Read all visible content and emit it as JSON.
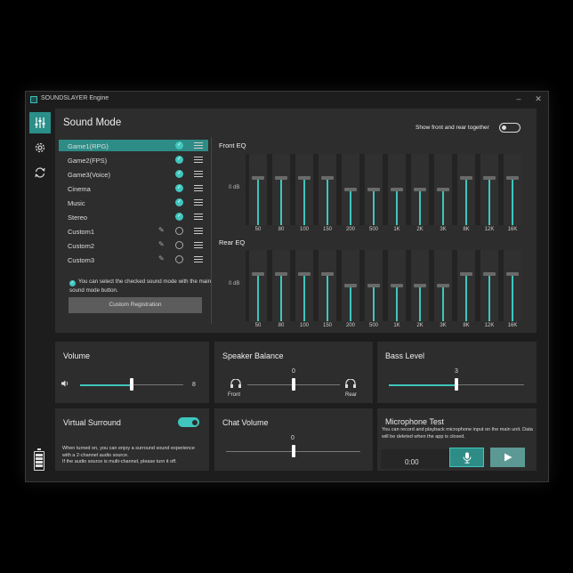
{
  "app": {
    "title": "SOUNDSLAYER Engine"
  },
  "window_controls": {
    "minimize": "–",
    "maximize": "□",
    "close": "✕"
  },
  "sidebar": {
    "items": [
      {
        "icon": "equalizer-icon",
        "active": true
      },
      {
        "icon": "gear-icon",
        "active": false
      },
      {
        "icon": "sync-icon",
        "active": false
      }
    ],
    "battery_icon": "battery-icon"
  },
  "sound_mode": {
    "title": "Sound Mode",
    "show_front_rear_label": "Show front and rear together",
    "show_front_rear_on": false,
    "modes": [
      {
        "label": "Game1(RPG)",
        "checked": true,
        "editable": false,
        "selected": true
      },
      {
        "label": "Game2(FPS)",
        "checked": true,
        "editable": false,
        "selected": false
      },
      {
        "label": "Game3(Voice)",
        "checked": true,
        "editable": false,
        "selected": false
      },
      {
        "label": "Cinema",
        "checked": true,
        "editable": false,
        "selected": false
      },
      {
        "label": "Music",
        "checked": true,
        "editable": false,
        "selected": false
      },
      {
        "label": "Stereo",
        "checked": true,
        "editable": false,
        "selected": false
      },
      {
        "label": "Custom1",
        "checked": false,
        "editable": true,
        "selected": false
      },
      {
        "label": "Custom2",
        "checked": false,
        "editable": true,
        "selected": false
      },
      {
        "label": "Custom3",
        "checked": false,
        "editable": true,
        "selected": false
      }
    ],
    "hint": "You can select the checked sound mode with the main sound mode button.",
    "custom_registration": "Custom Registration"
  },
  "eq": {
    "front_title": "Front EQ",
    "rear_title": "Rear EQ",
    "zero_label": "0 dB",
    "bands": [
      "50",
      "80",
      "100",
      "150",
      "200",
      "500",
      "1K",
      "2K",
      "3K",
      "8K",
      "12K",
      "16K"
    ],
    "front_levels": [
      0.66,
      0.66,
      0.66,
      0.66,
      0.5,
      0.5,
      0.5,
      0.5,
      0.5,
      0.66,
      0.66,
      0.66
    ],
    "rear_levels": [
      0.66,
      0.66,
      0.66,
      0.66,
      0.5,
      0.5,
      0.5,
      0.5,
      0.5,
      0.66,
      0.66,
      0.66
    ]
  },
  "volume": {
    "title": "Volume",
    "value": "8",
    "level": 0.5,
    "icon": "speaker-icon"
  },
  "speaker_balance": {
    "title": "Speaker Balance",
    "value": "0",
    "front_label": "Front",
    "rear_label": "Rear",
    "level": 0.5
  },
  "bass_level": {
    "title": "Bass Level",
    "value": "3",
    "level": 0.5
  },
  "virtual_surround": {
    "title": "Virtual Surround",
    "on": true,
    "desc1": "When turned on, you can enjoy a surround sound experience with a 2-channel audio source.",
    "desc2": "If the audio source is multi-channel, please turn it off."
  },
  "chat_volume": {
    "title": "Chat Volume",
    "value": "0",
    "level": 0.5
  },
  "mic_test": {
    "title": "Microphone Test",
    "desc": "You can record and playback microphone input on the main unit. Data will be deleted when the app is closed.",
    "time": "0:00"
  },
  "colors": {
    "accent": "#3fc6bd",
    "selected": "#2e8c86",
    "panel": "#2d2d2d",
    "window": "#1d1d1d"
  }
}
